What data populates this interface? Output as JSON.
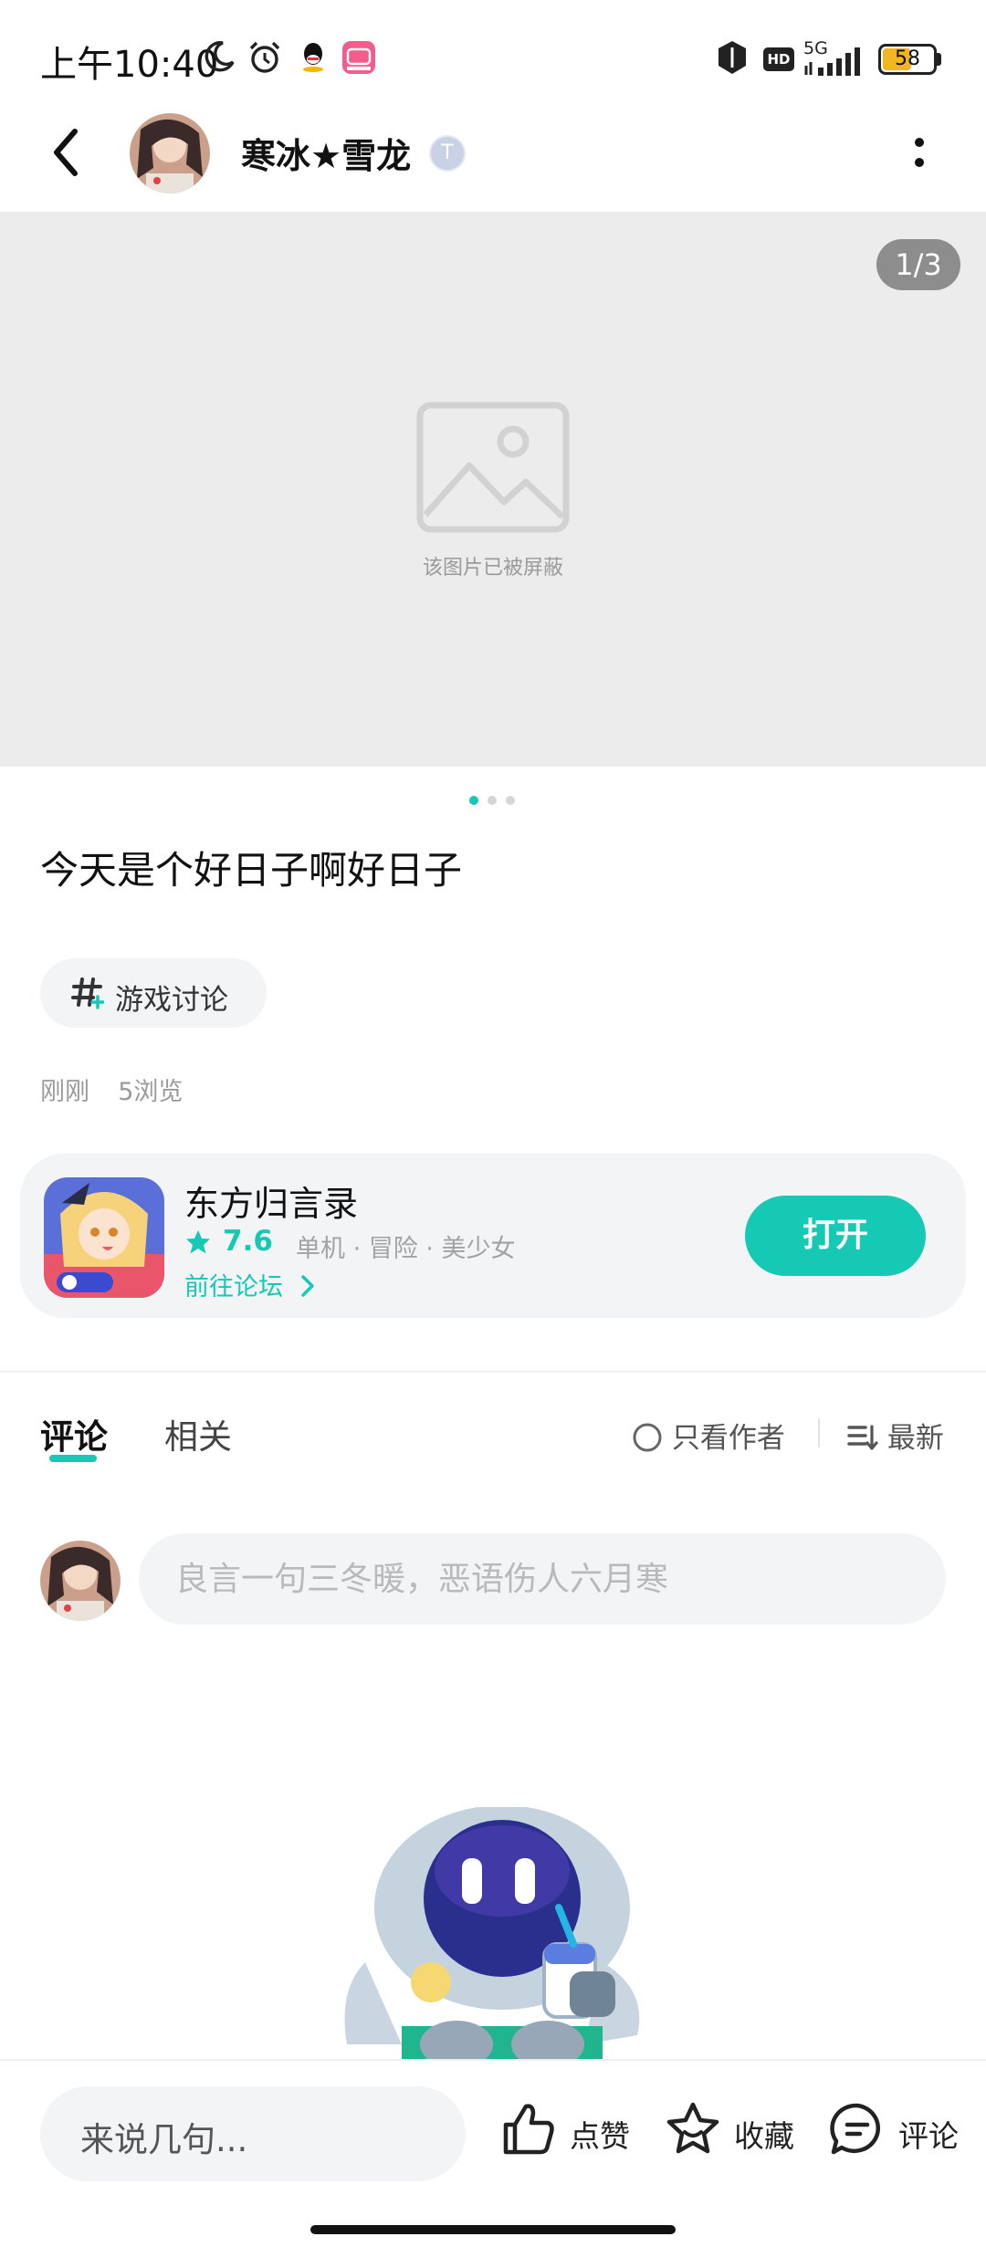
{
  "status_bar": {
    "time": "上午10:40",
    "icons": [
      "moon-icon",
      "alarm-icon",
      "qq-icon",
      "bilibili-icon",
      "shield-icon",
      "hd-icon",
      "5g-signal-icon"
    ],
    "network": "5G",
    "hd": "HD",
    "battery": "58",
    "battery_level": 0.58
  },
  "header": {
    "username": "寒冰★雪龙",
    "level_badge": "T",
    "icons": [
      "back-icon",
      "more-icon"
    ]
  },
  "gallery": {
    "counter": "1/3",
    "blocked_text": "该图片已被屏蔽",
    "page_count": 3,
    "active_index": 0
  },
  "post": {
    "title": "今天是个好日子啊好日子",
    "topic": "游戏讨论",
    "time": "刚刚",
    "views": "5浏览"
  },
  "game_card": {
    "name": "东方归言录",
    "rating": "7.6",
    "tags": "单机 · 冒险 · 美少女",
    "forum_link": "前往论坛",
    "open_button": "打开",
    "accent": "#15c9b4"
  },
  "tabs": {
    "comments": "评论",
    "related": "相关",
    "author_only": "只看作者",
    "sort": "最新"
  },
  "comment_box": {
    "placeholder": "良言一句三冬暖，恶语伤人六月寒"
  },
  "bottom_bar": {
    "reply_placeholder": "来说几句...",
    "like": "点赞",
    "favorite": "收藏",
    "comment": "评论"
  }
}
